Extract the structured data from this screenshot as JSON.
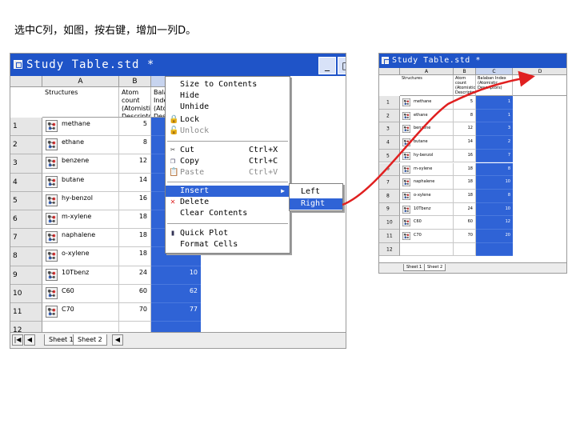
{
  "instruction": "选中C列，如图，按右键，增加一列D。",
  "window": {
    "title": "Study Table.std *",
    "minimize_label": "_",
    "maximize_label": "□"
  },
  "columns": {
    "row_header": "",
    "a": {
      "letter": "A",
      "field": "Structures"
    },
    "b": {
      "letter": "B",
      "field": "Atom count (Atomistic Descriptors)"
    },
    "c": {
      "letter": "C",
      "field": "Balaban Index (Atomistic Descriptors)"
    }
  },
  "rows": [
    {
      "num": "1",
      "name": "methane",
      "b": "5",
      "c": ""
    },
    {
      "num": "2",
      "name": "ethane",
      "b": "8",
      "c": ""
    },
    {
      "num": "3",
      "name": "benzene",
      "b": "12",
      "c": ""
    },
    {
      "num": "4",
      "name": "butane",
      "b": "14",
      "c": ""
    },
    {
      "num": "5",
      "name": "hy-benzol",
      "b": "16",
      "c": ""
    },
    {
      "num": "6",
      "name": "m-xylene",
      "b": "18",
      "c": ""
    },
    {
      "num": "7",
      "name": "naphalene",
      "b": "18",
      "c": ""
    },
    {
      "num": "8",
      "name": "o-xylene",
      "b": "18",
      "c": ""
    },
    {
      "num": "9",
      "name": "10Tbenz",
      "b": "24",
      "c": "10"
    },
    {
      "num": "10",
      "name": "C60",
      "b": "60",
      "c": "62"
    },
    {
      "num": "11",
      "name": "C70",
      "b": "70",
      "c": "77"
    },
    {
      "num": "12",
      "name": "",
      "b": "",
      "c": ""
    }
  ],
  "sheet_tabs": [
    "Sheet 1",
    "Sheet 2"
  ],
  "context_menu": {
    "items": [
      {
        "label": "Size to Contents",
        "shortcut": "",
        "icon": "",
        "disabled": false
      },
      {
        "label": "Hide",
        "shortcut": "",
        "icon": "",
        "disabled": false
      },
      {
        "label": "Unhide",
        "shortcut": "",
        "icon": "",
        "disabled": false
      },
      {
        "label": "Lock",
        "shortcut": "",
        "icon": "lock-icon",
        "disabled": false
      },
      {
        "label": "Unlock",
        "shortcut": "",
        "icon": "unlock-icon",
        "disabled": true
      },
      {
        "label": "Cut",
        "shortcut": "Ctrl+X",
        "icon": "scissors-icon",
        "disabled": false
      },
      {
        "label": "Copy",
        "shortcut": "Ctrl+C",
        "icon": "copy-icon",
        "disabled": false
      },
      {
        "label": "Paste",
        "shortcut": "Ctrl+V",
        "icon": "paste-icon",
        "disabled": true
      },
      {
        "label": "Insert",
        "shortcut": "",
        "icon": "",
        "disabled": false
      },
      {
        "label": "Delete",
        "shortcut": "",
        "icon": "delete-x-icon",
        "disabled": false
      },
      {
        "label": "Clear Contents",
        "shortcut": "",
        "icon": "",
        "disabled": false
      },
      {
        "label": "Quick Plot",
        "shortcut": "",
        "icon": "chart-icon",
        "disabled": false
      },
      {
        "label": "Format Cells",
        "shortcut": "",
        "icon": "",
        "disabled": false
      }
    ],
    "submenu_arrow": "▶"
  },
  "submenu": {
    "left": "Left",
    "right": "Right"
  },
  "result_window": {
    "title": "Study Table.std *",
    "columns": {
      "a": "A",
      "b": "B",
      "c": "C",
      "d": "D"
    },
    "fields": {
      "a": "Structures",
      "b": "Atom count (Atomistic Descriptors)",
      "c": "Balaban Index (Atomistic Descriptors)"
    },
    "rows": [
      {
        "num": "1",
        "name": "methane",
        "b": "5",
        "c": "1"
      },
      {
        "num": "2",
        "name": "ethane",
        "b": "8",
        "c": "1"
      },
      {
        "num": "3",
        "name": "benzene",
        "b": "12",
        "c": "3"
      },
      {
        "num": "4",
        "name": "butane",
        "b": "14",
        "c": "2"
      },
      {
        "num": "5",
        "name": "hy-benzol",
        "b": "16",
        "c": "7"
      },
      {
        "num": "6",
        "name": "m-xylene",
        "b": "18",
        "c": "8"
      },
      {
        "num": "7",
        "name": "naphalene",
        "b": "18",
        "c": "10"
      },
      {
        "num": "8",
        "name": "o-xylene",
        "b": "18",
        "c": "8"
      },
      {
        "num": "9",
        "name": "10Tbenz",
        "b": "24",
        "c": "10"
      },
      {
        "num": "10",
        "name": "C60",
        "b": "60",
        "c": "12"
      },
      {
        "num": "11",
        "name": "C70",
        "b": "70",
        "c": "20"
      },
      {
        "num": "12",
        "name": "",
        "b": "",
        "c": ""
      }
    ],
    "sheet_tabs": [
      "Sheet 1",
      "Sheet 2"
    ]
  },
  "colors": {
    "selection": "#2f63d6",
    "titlebar": "#1f54c8",
    "arrow": "#e02020"
  }
}
